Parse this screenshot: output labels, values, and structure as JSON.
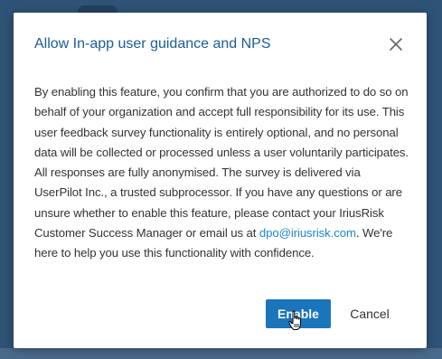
{
  "dialog": {
    "title": "Allow In-app user guidance and NPS",
    "close_icon": "close-icon",
    "body_before_link": "By enabling this feature, you confirm that you are authorized to do so on behalf of your organization and accept full responsibility for its use. This user feedback survey functionality is entirely optional, and no personal data will be collected or processed unless a user voluntarily participates. All responses are fully anonymised. The survey is delivered via UserPilot Inc., a trusted subprocessor. If you have any questions or are unsure whether to enable this feature, please contact your IriusRisk Customer Success Manager or email us at ",
    "email_link": "dpo@iriusrisk.com",
    "body_after_link": ". We're here to help you use this functionality with confidence.",
    "enable_label": "Enable",
    "cancel_label": "Cancel"
  },
  "colors": {
    "backdrop": "#2f5376",
    "title": "#1a5d94",
    "link": "#1f87c4",
    "primary_button": "#1b75bb"
  },
  "cursor_icon": "hand-pointer-icon"
}
